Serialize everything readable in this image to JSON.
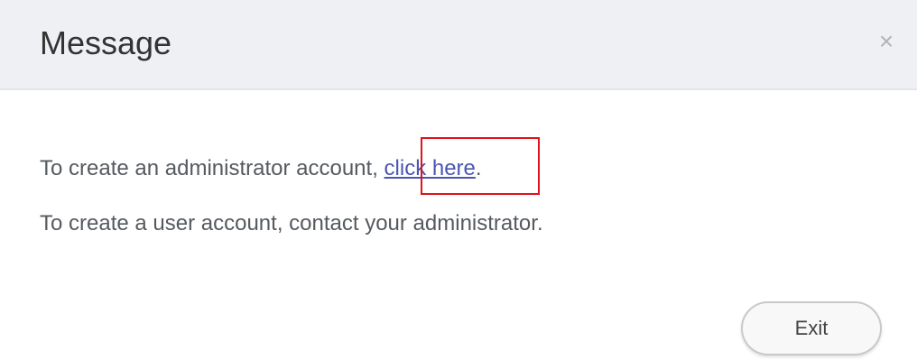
{
  "dialog": {
    "title": "Message",
    "close_icon": "close-icon",
    "close_glyph": "×",
    "line1_prefix": "To create an administrator account, ",
    "line1_link": "click here",
    "line1_suffix": ".",
    "line2": "To create a user account, contact your administrator.",
    "exit_label": "Exit"
  },
  "colors": {
    "header_bg": "#eef0f3",
    "link": "#4b56b0",
    "highlight_border": "#e0121b",
    "body_text": "#555a5f"
  }
}
